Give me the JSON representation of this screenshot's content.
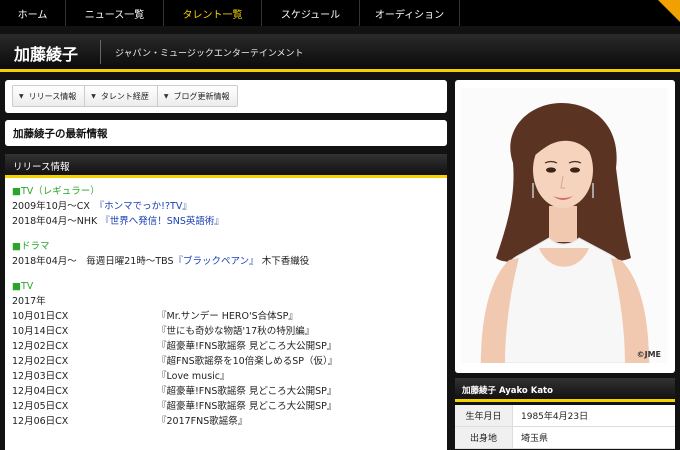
{
  "nav": {
    "items": [
      {
        "label": "ホーム",
        "active": false
      },
      {
        "label": "ニュース一覧",
        "active": false
      },
      {
        "label": "タレント一覧",
        "active": true
      },
      {
        "label": "スケジュール",
        "active": false
      },
      {
        "label": "オーディション",
        "active": false
      }
    ]
  },
  "header": {
    "name": "加藤綾子",
    "agency": "ジャパン・ミュージックエンターテインメント"
  },
  "subtabs": [
    "リリース情報",
    "タレント経歴",
    "ブログ更新情報"
  ],
  "latest_title": "加藤綾子の最新情報",
  "release_title": "リリース情報",
  "release": {
    "tv_regular": {
      "title": "■TV（レギュラー）",
      "lines": [
        {
          "text": "2009年10月〜CX　",
          "link": "『ホンマでっか!?TV』"
        },
        {
          "text": "2018年04月〜NHK ",
          "link": "『世界へ発信！SNS英語術』"
        }
      ]
    },
    "drama": {
      "title": "■ドラマ",
      "pre": "2018年04月〜　毎週日曜21時〜TBS",
      "link": "『ブラックペアン』",
      "post": "木下香織役"
    },
    "tv": {
      "title": "■TV",
      "year": "2017年",
      "rows": [
        {
          "date": "10月01日CX",
          "program": "『Mr.サンデー HERO'S合体SP』"
        },
        {
          "date": "10月14日CX",
          "program": "『世にも奇妙な物語'17秋の特別編』"
        },
        {
          "date": "12月02日CX",
          "program": "『超豪華!FNS歌謡祭 見どころ大公開SP』"
        },
        {
          "date": "12月02日CX",
          "program": "『超FNS歌謡祭を10倍楽しめるSP（仮）』"
        },
        {
          "date": "12月03日CX",
          "program": "『Love music』"
        },
        {
          "date": "12月04日CX",
          "program": "『超豪華!FNS歌謡祭 見どころ大公開SP』"
        },
        {
          "date": "12月05日CX",
          "program": "『超豪華!FNS歌謡祭 見どころ大公開SP』"
        },
        {
          "date": "12月06日CX",
          "program": "『2017FNS歌謡祭』"
        }
      ]
    }
  },
  "photo_credit": "©JME",
  "profile": {
    "title": "加藤綾子  Ayako Kato",
    "rows": [
      {
        "label": "生年月日",
        "value": "1985年4月23日"
      },
      {
        "label": "出身地",
        "value": "埼玉県"
      }
    ]
  },
  "colors": {
    "accent": "#f5d100",
    "section_green": "#2aa52a",
    "link_blue": "#1a3fb5",
    "corner_badge": "#f0a000"
  }
}
